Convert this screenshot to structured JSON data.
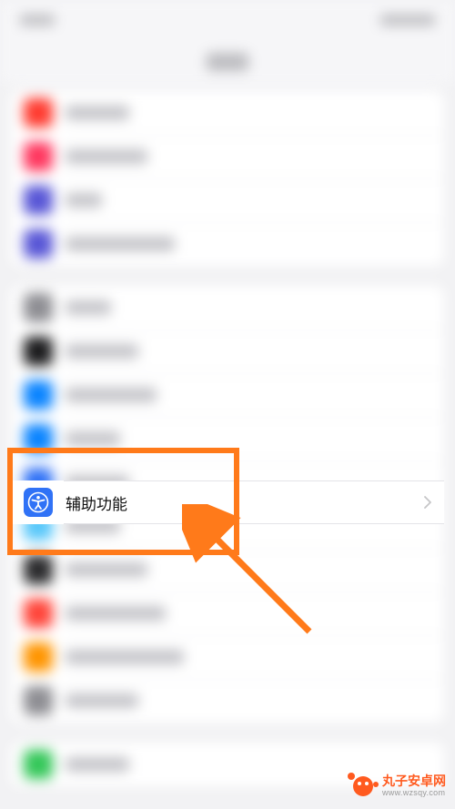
{
  "header": {
    "title": "设置"
  },
  "groups": [
    {
      "rows": [
        {
          "icon_color": "#ff3b30",
          "label_width": 70
        },
        {
          "icon_color": "#ff375f",
          "label_width": 90
        },
        {
          "icon_color": "#5856d6",
          "label_width": 40
        },
        {
          "icon_color": "#5856d6",
          "label_width": 120
        }
      ]
    },
    {
      "rows": [
        {
          "icon_color": "#8e8e93",
          "label_width": 50
        },
        {
          "icon_color": "#1c1c1e",
          "label_width": 80
        },
        {
          "icon_color": "#0a84ff",
          "label_width": 100
        },
        {
          "icon_color": "#0a84ff",
          "label_width": 60
        },
        {
          "key": "accessibility",
          "icon_color": "#3072f6",
          "label": "辅助功能"
        },
        {
          "icon_color": "#5ac8fa",
          "label_width": 60
        },
        {
          "icon_color": "#2c2c2e",
          "label_width": 90
        },
        {
          "icon_color": "#ff453a",
          "label_width": 110
        },
        {
          "icon_color": "#ff9500",
          "label_width": 130
        },
        {
          "icon_color": "#8e8e93",
          "label_width": 80
        }
      ]
    },
    {
      "rows": [
        {
          "icon_color": "#34c759",
          "label_width": 70
        }
      ]
    }
  ],
  "focused": {
    "label": "辅助功能",
    "icon_name": "accessibility-icon"
  },
  "watermark": {
    "title": "丸子安卓网",
    "url": "www.wzsqy.com"
  }
}
